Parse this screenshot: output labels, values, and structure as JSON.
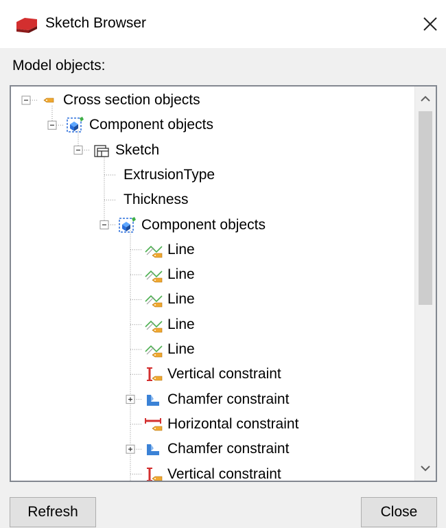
{
  "window": {
    "title": "Sketch Browser",
    "close_icon": "close-icon",
    "app_icon": "sketch-browser-icon"
  },
  "section_label": "Model objects:",
  "tree": {
    "nodes": [
      {
        "label": "Cross section objects",
        "icon": "cross-section-icon",
        "expander": "minus"
      },
      {
        "label": "Component objects",
        "icon": "component-objects-icon",
        "expander": "minus"
      },
      {
        "label": "Sketch",
        "icon": "sketch-icon",
        "expander": "minus"
      },
      {
        "label": "ExtrusionType",
        "icon": "",
        "expander": "none"
      },
      {
        "label": "Thickness",
        "icon": "",
        "expander": "none"
      },
      {
        "label": "Component objects",
        "icon": "component-objects-icon",
        "expander": "minus"
      },
      {
        "label": "Line",
        "icon": "line-icon",
        "expander": "none"
      },
      {
        "label": "Line",
        "icon": "line-icon",
        "expander": "none"
      },
      {
        "label": "Line",
        "icon": "line-icon",
        "expander": "none"
      },
      {
        "label": "Line",
        "icon": "line-icon",
        "expander": "none"
      },
      {
        "label": "Line",
        "icon": "line-icon",
        "expander": "none"
      },
      {
        "label": "Vertical constraint",
        "icon": "vertical-constraint-icon",
        "expander": "none"
      },
      {
        "label": "Chamfer constraint",
        "icon": "chamfer-constraint-icon",
        "expander": "plus"
      },
      {
        "label": "Horizontal constraint",
        "icon": "horizontal-constraint-icon",
        "expander": "none"
      },
      {
        "label": "Chamfer constraint",
        "icon": "chamfer-constraint-icon",
        "expander": "plus"
      },
      {
        "label": "Vertical constraint",
        "icon": "vertical-constraint-icon",
        "expander": "none"
      }
    ]
  },
  "buttons": {
    "refresh": "Refresh",
    "close": "Close"
  },
  "colors": {
    "accent_red": "#d32f2f",
    "tag_orange": "#f0a830",
    "line_green": "#4caf50",
    "chamfer_blue": "#3b82d6"
  }
}
